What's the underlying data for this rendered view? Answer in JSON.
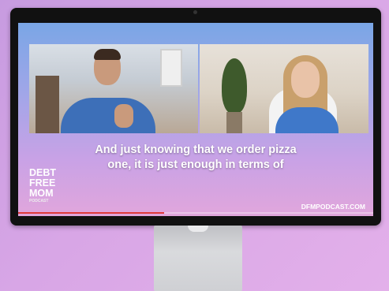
{
  "caption": {
    "line1": "And just knowing that we order pizza",
    "line2": "one, it is just enough in terms of"
  },
  "logo": {
    "line1": "DEBT",
    "line2": "FREE",
    "line3": "MOM",
    "subline": "PODCAST"
  },
  "url": "DFMPODCAST.COM",
  "progress": {
    "fraction": 0.41,
    "color": "#e03a3a"
  },
  "colors": {
    "background": "#d8a6e6",
    "bezel": "#111111",
    "caption_text": "#ffffff"
  }
}
